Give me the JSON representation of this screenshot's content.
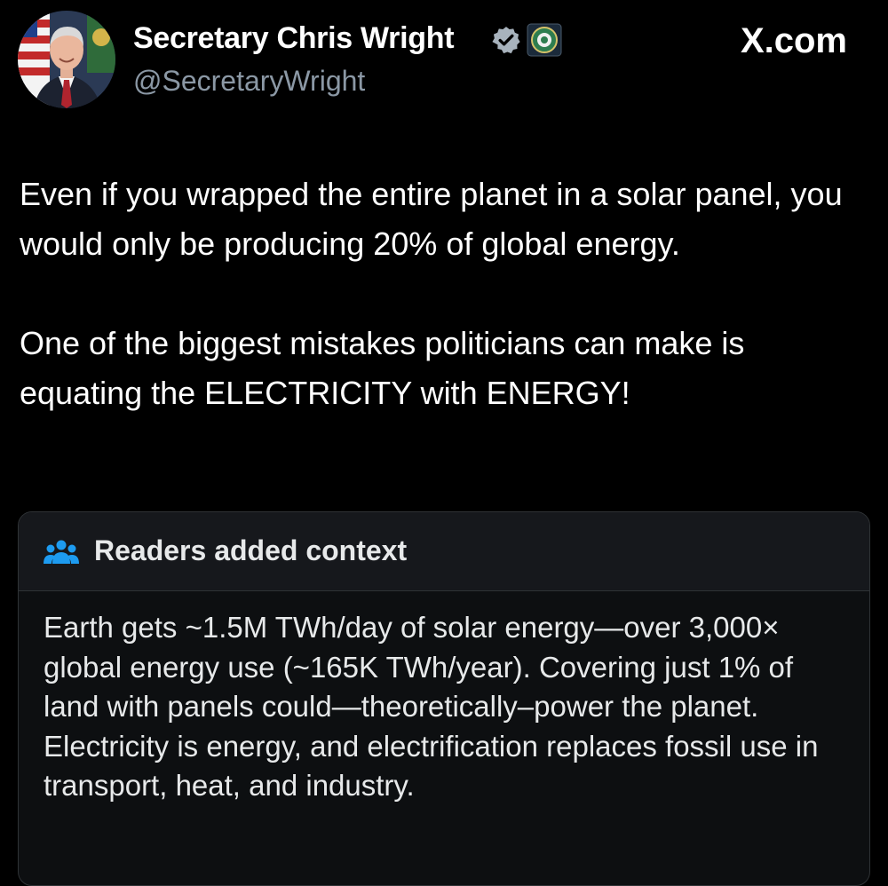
{
  "account": {
    "display_name": "Secretary Chris Wright",
    "handle": "@SecretaryWright",
    "verified": true
  },
  "site_label": "X.com",
  "tweet": {
    "paragraphs": [
      "Even if you wrapped the entire planet in a solar panel, you would only be producing 20% of global energy.",
      "One of the biggest mistakes politicians can make is equating the ELECTRICITY with ENERGY!"
    ]
  },
  "community_note": {
    "title": "Readers added context",
    "body": "Earth gets ~1.5M TWh/day of solar energy—over 3,000× global energy use (~165K TWh/year). Covering just 1% of land with panels could—theoretically–power the planet. Electricity is energy, and electrification replaces fossil use in transport, heat, and industry."
  },
  "icons": {
    "verified": "verified-badge-icon",
    "affiliate": "doe-seal-icon",
    "note": "people-group-icon"
  },
  "colors": {
    "background": "#000000",
    "text_primary": "#ffffff",
    "text_secondary": "#8b98a5",
    "note_header_bg": "#16181c",
    "note_border": "#2f3336",
    "note_icon": "#1d9bf0",
    "verified_badge": "#a8b3bd"
  }
}
